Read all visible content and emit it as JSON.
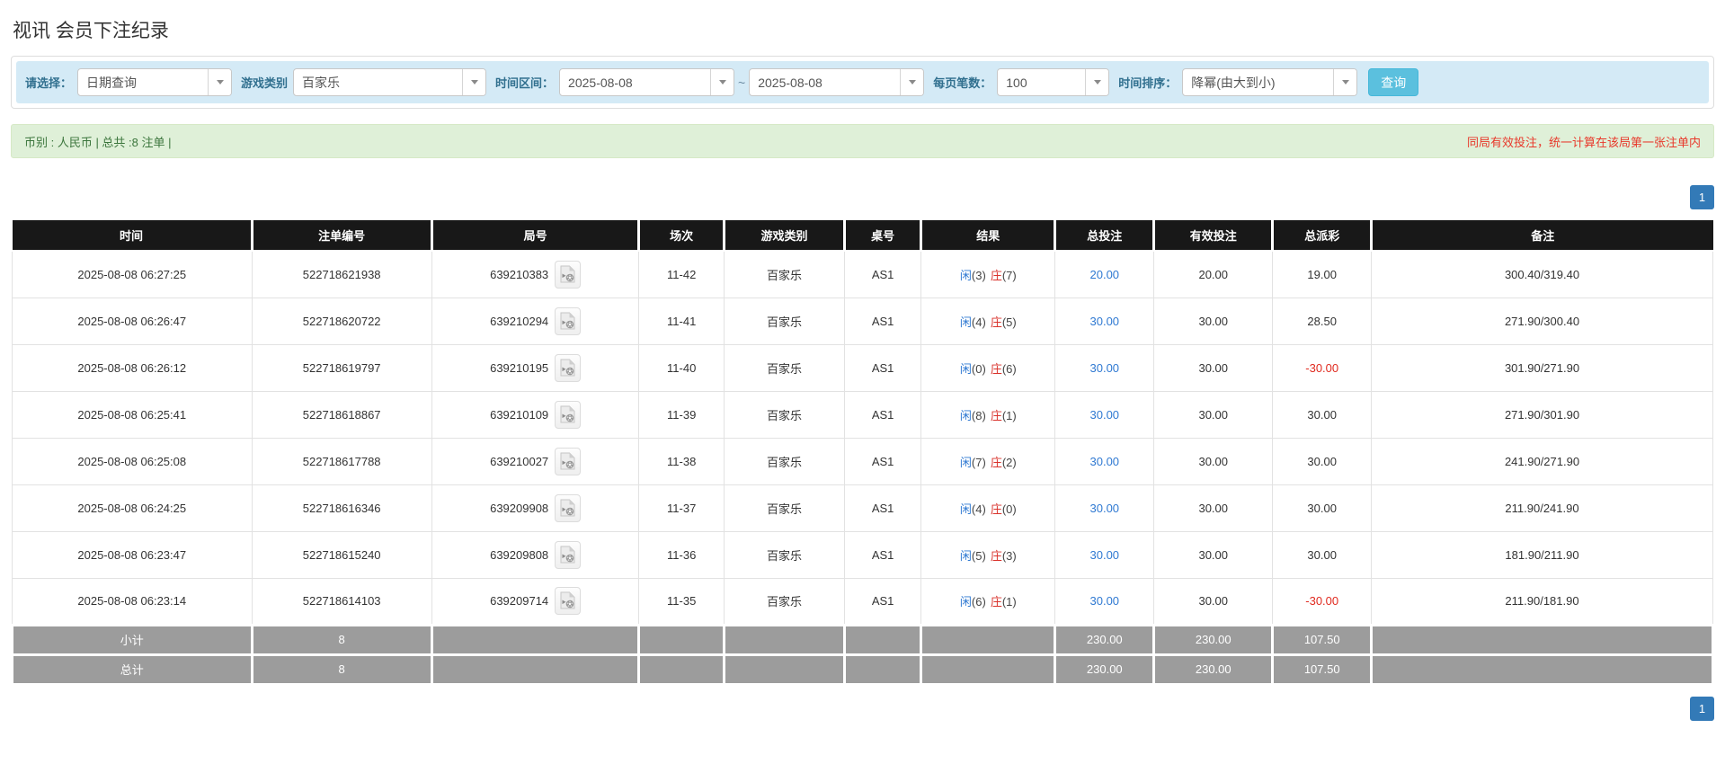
{
  "page": {
    "title": "视讯 会员下注纪录"
  },
  "filters": {
    "select_label": "请选择：",
    "select_value": "日期查询",
    "game_label": "游戏类别",
    "game_value": "百家乐",
    "range_label": "时间区间：",
    "date_from": "2025-08-08",
    "tilde": "~",
    "date_to": "2025-08-08",
    "per_page_label": "每页笔数：",
    "per_page_value": "100",
    "sort_label": "时间排序：",
    "sort_value": "降幂(由大到小)",
    "search_button": "查询"
  },
  "summary": {
    "left": "币别 : 人民币 | 总共 :8 注单 |",
    "right": "同局有效投注，统一计算在该局第一张注单内"
  },
  "pagination": {
    "page": "1"
  },
  "icons": {
    "video_icon": "video-clip-icon",
    "dropdown_arrow": "chevron-down-icon"
  },
  "colors": {
    "accent_blue": "#337ab7",
    "search_button": "#5bc0de",
    "filter_bg": "#d4eaf6",
    "summary_bg": "#dff0d8",
    "header_bg": "#181818",
    "footer_bg": "#9c9c9c",
    "player_blue": "#2f79d2",
    "banker_red": "#d9332c",
    "negative_red": "#e02a1f",
    "notice_red": "#e8392b"
  },
  "table": {
    "headers": [
      "时间",
      "注单编号",
      "局号",
      "场次",
      "游戏类别",
      "桌号",
      "结果",
      "总投注",
      "有效投注",
      "总派彩",
      "备注"
    ],
    "rows": [
      {
        "time": "2025-08-08 06:27:25",
        "bet_id": "522718621938",
        "round_id": "639210383",
        "session": "11-42",
        "game": "百家乐",
        "table_no": "AS1",
        "player": "闲",
        "player_score": "(3)",
        "banker": "庄",
        "banker_score": "(7)",
        "total_bet": "20.00",
        "valid_bet": "20.00",
        "payout": "19.00",
        "remark": "300.40/319.40"
      },
      {
        "time": "2025-08-08 06:26:47",
        "bet_id": "522718620722",
        "round_id": "639210294",
        "session": "11-41",
        "game": "百家乐",
        "table_no": "AS1",
        "player": "闲",
        "player_score": "(4)",
        "banker": "庄",
        "banker_score": "(5)",
        "total_bet": "30.00",
        "valid_bet": "30.00",
        "payout": "28.50",
        "remark": "271.90/300.40"
      },
      {
        "time": "2025-08-08 06:26:12",
        "bet_id": "522718619797",
        "round_id": "639210195",
        "session": "11-40",
        "game": "百家乐",
        "table_no": "AS1",
        "player": "闲",
        "player_score": "(0)",
        "banker": "庄",
        "banker_score": "(6)",
        "total_bet": "30.00",
        "valid_bet": "30.00",
        "payout": "-30.00",
        "remark": "301.90/271.90"
      },
      {
        "time": "2025-08-08 06:25:41",
        "bet_id": "522718618867",
        "round_id": "639210109",
        "session": "11-39",
        "game": "百家乐",
        "table_no": "AS1",
        "player": "闲",
        "player_score": "(8)",
        "banker": "庄",
        "banker_score": "(1)",
        "total_bet": "30.00",
        "valid_bet": "30.00",
        "payout": "30.00",
        "remark": "271.90/301.90"
      },
      {
        "time": "2025-08-08 06:25:08",
        "bet_id": "522718617788",
        "round_id": "639210027",
        "session": "11-38",
        "game": "百家乐",
        "table_no": "AS1",
        "player": "闲",
        "player_score": "(7)",
        "banker": "庄",
        "banker_score": "(2)",
        "total_bet": "30.00",
        "valid_bet": "30.00",
        "payout": "30.00",
        "remark": "241.90/271.90"
      },
      {
        "time": "2025-08-08 06:24:25",
        "bet_id": "522718616346",
        "round_id": "639209908",
        "session": "11-37",
        "game": "百家乐",
        "table_no": "AS1",
        "player": "闲",
        "player_score": "(4)",
        "banker": "庄",
        "banker_score": "(0)",
        "total_bet": "30.00",
        "valid_bet": "30.00",
        "payout": "30.00",
        "remark": "211.90/241.90"
      },
      {
        "time": "2025-08-08 06:23:47",
        "bet_id": "522718615240",
        "round_id": "639209808",
        "session": "11-36",
        "game": "百家乐",
        "table_no": "AS1",
        "player": "闲",
        "player_score": "(5)",
        "banker": "庄",
        "banker_score": "(3)",
        "total_bet": "30.00",
        "valid_bet": "30.00",
        "payout": "30.00",
        "remark": "181.90/211.90"
      },
      {
        "time": "2025-08-08 06:23:14",
        "bet_id": "522718614103",
        "round_id": "639209714",
        "session": "11-35",
        "game": "百家乐",
        "table_no": "AS1",
        "player": "闲",
        "player_score": "(6)",
        "banker": "庄",
        "banker_score": "(1)",
        "total_bet": "30.00",
        "valid_bet": "30.00",
        "payout": "-30.00",
        "remark": "211.90/181.90"
      }
    ],
    "footer": [
      {
        "label": "小计",
        "count": "8",
        "total_bet": "230.00",
        "valid_bet": "230.00",
        "payout": "107.50"
      },
      {
        "label": "总计",
        "count": "8",
        "total_bet": "230.00",
        "valid_bet": "230.00",
        "payout": "107.50"
      }
    ]
  }
}
